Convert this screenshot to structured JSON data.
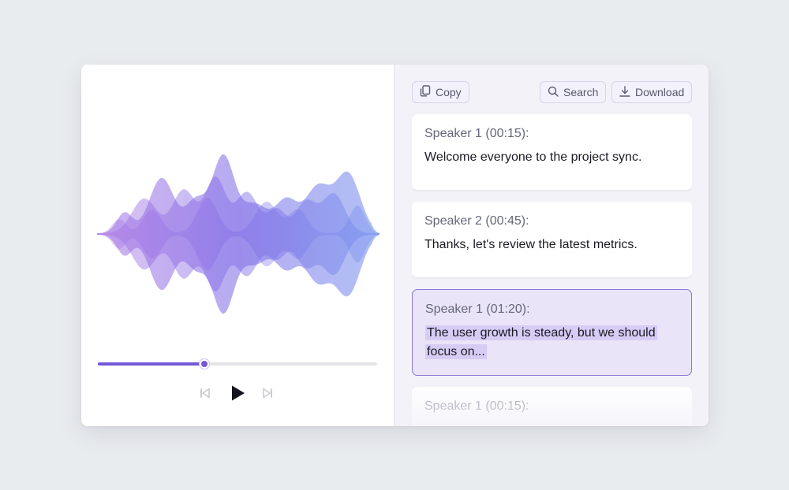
{
  "player": {
    "progress": 0.38,
    "controls": {
      "previous_icon": "skip-previous-icon",
      "play_icon": "play-icon",
      "next_icon": "skip-next-icon"
    },
    "waveform_colors": [
      "#9b6fe0",
      "#7b6be6",
      "#6f86ea"
    ]
  },
  "toolbar": {
    "copy_label": "Copy",
    "copy_icon": "copy-icon",
    "search_label": "Search",
    "search_icon": "search-icon",
    "download_label": "Download",
    "download_icon": "download-icon"
  },
  "transcript": [
    {
      "speaker": "Speaker 1 (00:15):",
      "text": "Welcome everyone to the project sync."
    },
    {
      "speaker": "Speaker 2 (00:45):",
      "text": "Thanks, let's review the latest metrics."
    },
    {
      "speaker": "Speaker 1 (01:20):",
      "text": "The user growth is steady, but we should focus on...",
      "active": true
    },
    {
      "speaker": "Speaker 1 (00:15):",
      "text": ""
    }
  ],
  "colors": {
    "accent": "#7558d6",
    "active_card_bg": "#e9e4f7",
    "active_card_border": "#8c78d4",
    "highlight": "#d6ccf4"
  }
}
